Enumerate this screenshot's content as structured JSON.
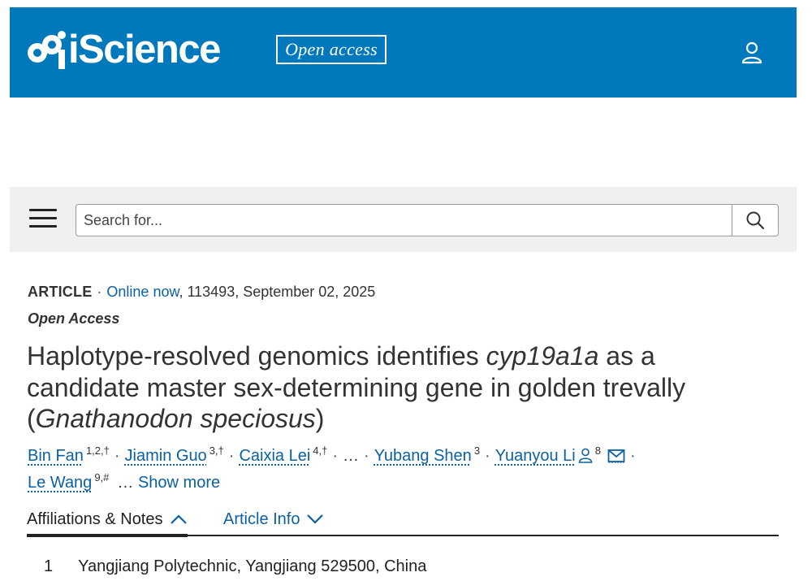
{
  "header": {
    "logo_text": "iScience",
    "badge": "Open access",
    "brand_color": "#0079bc",
    "user_icon": "user-icon"
  },
  "search": {
    "placeholder": "Search for...",
    "menu_icon": "hamburger-menu-icon",
    "search_icon": "search-icon"
  },
  "article": {
    "type": "ARTICLE",
    "status": "Online now",
    "rest_meta": ", 113493, September 02, 2025",
    "open_access": "Open Access",
    "title_parts": [
      "Haplotype-resolved genomics identifies ",
      "cyp19a1a",
      " as a candidate master sex-determining gene in golden trevally (",
      "Gnathanodon speciosus",
      ")"
    ],
    "authors": [
      {
        "name": "Bin Fan",
        "sup": "1,2,†"
      },
      {
        "name": "Jiamin Guo",
        "sup": "3,†"
      },
      {
        "name": "Caixia Lei",
        "sup": "4,†"
      },
      {
        "name": "Yubang Shen",
        "sup": "3"
      },
      {
        "name": "Yuanyou Li",
        "sup": "8"
      },
      {
        "name": "Le Wang",
        "sup": "9,#"
      }
    ],
    "ellipsis": "…",
    "show_more": "Show more"
  },
  "tabs": [
    {
      "label": "Affiliations & Notes",
      "icon": "chevron-up-icon",
      "active": true
    },
    {
      "label": "Article Info",
      "icon": "chevron-down-icon",
      "active": false
    }
  ],
  "affiliations": [
    {
      "num": "1",
      "text": "Yangjiang Polytechnic, Yangjiang 529500, China"
    }
  ]
}
